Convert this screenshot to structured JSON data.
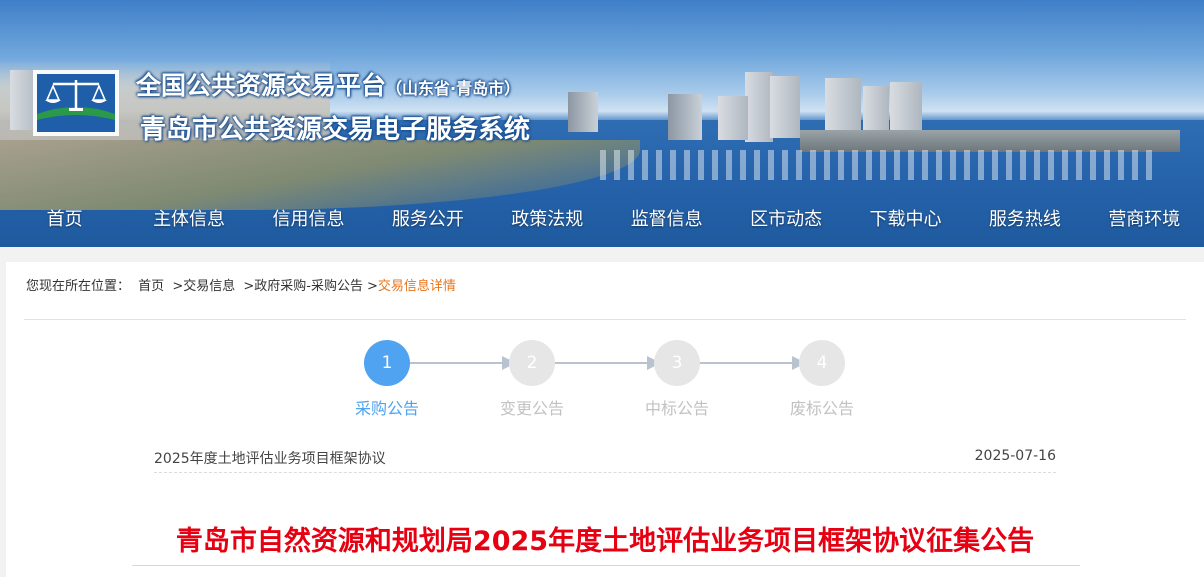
{
  "header": {
    "title_main": "全国公共资源交易平台",
    "title_region": "（山东省·青岛市）",
    "title_sub": "青岛市公共资源交易电子服务系统",
    "logo_icon": "scales-of-justice-icon"
  },
  "nav": {
    "items": [
      "首页",
      "主体信息",
      "信用信息",
      "服务公开",
      "政策法规",
      "监督信息",
      "区市动态",
      "下载中心",
      "服务热线",
      "营商环境"
    ]
  },
  "breadcrumb": {
    "prefix": "您现在所在位置：",
    "items": [
      "首页",
      ">交易信息",
      ">政府采购-采购公告",
      ">"
    ],
    "current": "交易信息详情"
  },
  "steps": [
    {
      "number": "1",
      "label": "采购公告",
      "active": true
    },
    {
      "number": "2",
      "label": "变更公告",
      "active": false
    },
    {
      "number": "3",
      "label": "中标公告",
      "active": false
    },
    {
      "number": "4",
      "label": "废标公告",
      "active": false
    }
  ],
  "project": {
    "title": "2025年度土地评估业务项目框架协议",
    "date": "2025-07-16"
  },
  "article": {
    "headline": "青岛市自然资源和规划局2025年度土地评估业务项目框架协议征集公告"
  },
  "colors": {
    "accent_blue": "#4fa3f0",
    "headline_red": "#e60012",
    "breadcrumb_current": "#e8741b",
    "inactive_step": "#e6e6e6"
  }
}
